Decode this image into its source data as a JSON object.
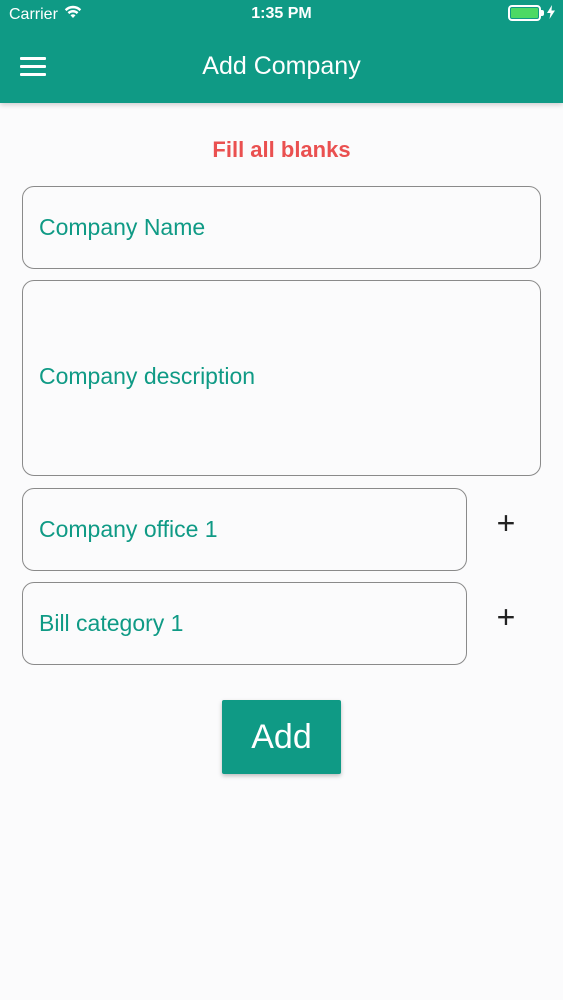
{
  "status_bar": {
    "carrier": "Carrier",
    "time": "1:35 PM",
    "icons": [
      "wifi-icon",
      "battery-icon",
      "charging-icon"
    ],
    "battery_color": "#4cd964"
  },
  "header": {
    "title": "Add Company",
    "menu_icon": "hamburger-menu-icon",
    "background": "#0f9a85"
  },
  "form": {
    "error_message": "Fill all blanks",
    "error_color": "#ea5050",
    "company_name": {
      "value": "",
      "placeholder": "Company Name"
    },
    "company_description": {
      "value": "",
      "placeholder": "Company description"
    },
    "offices": [
      {
        "value": "",
        "placeholder": "Company office 1"
      }
    ],
    "bill_categories": [
      {
        "value": "",
        "placeholder": "Bill category 1"
      }
    ],
    "add_office_icon": "+",
    "add_bill_category_icon": "+",
    "submit_label": "Add"
  }
}
